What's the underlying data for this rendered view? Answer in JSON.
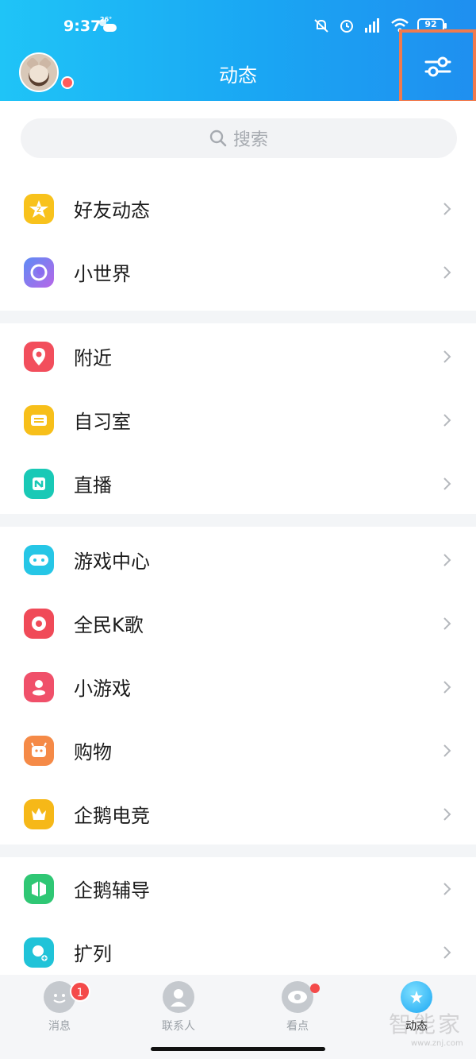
{
  "status_bar": {
    "time": "9:37",
    "temperature": "26°",
    "battery": "92"
  },
  "header": {
    "title": "动态",
    "accent_color": "#1aa6f3",
    "highlight_color": "#f07a4e"
  },
  "search": {
    "placeholder": "搜索"
  },
  "groups": [
    {
      "items": [
        {
          "label": "好友动态",
          "icon": "qzone-star-icon",
          "color": "#f8c21c"
        },
        {
          "label": "小世界",
          "icon": "small-world-icon",
          "color": "#8a6cf0"
        }
      ]
    },
    {
      "items": [
        {
          "label": "附近",
          "icon": "location-pin-icon",
          "color": "#f24e5c"
        },
        {
          "label": "自习室",
          "icon": "study-room-icon",
          "color": "#f7bf1a"
        },
        {
          "label": "直播",
          "icon": "live-icon",
          "color": "#19c9b6"
        }
      ]
    },
    {
      "items": [
        {
          "label": "游戏中心",
          "icon": "gamepad-icon",
          "color": "#26c6e6"
        },
        {
          "label": "全民K歌",
          "icon": "karaoke-icon",
          "color": "#f04a58"
        },
        {
          "label": "小游戏",
          "icon": "mini-game-icon",
          "color": "#f0506a"
        },
        {
          "label": "购物",
          "icon": "shopping-icon",
          "color": "#f58a47"
        },
        {
          "label": "企鹅电竞",
          "icon": "esports-crown-icon",
          "color": "#f6b818"
        }
      ]
    },
    {
      "items": [
        {
          "label": "企鹅辅导",
          "icon": "tutoring-book-icon",
          "color": "#2fc774"
        },
        {
          "label": "扩列",
          "icon": "add-friend-icon",
          "color": "#20c3d8"
        }
      ]
    }
  ],
  "tabs": [
    {
      "label": "消息",
      "badge": "1",
      "icon": "message-icon"
    },
    {
      "label": "联系人",
      "icon": "contacts-icon"
    },
    {
      "label": "看点",
      "icon": "eye-icon"
    },
    {
      "label": "动态",
      "icon": "planet-icon",
      "active": true
    }
  ],
  "watermark": {
    "text": "智能家",
    "url": "www.znj.com"
  }
}
